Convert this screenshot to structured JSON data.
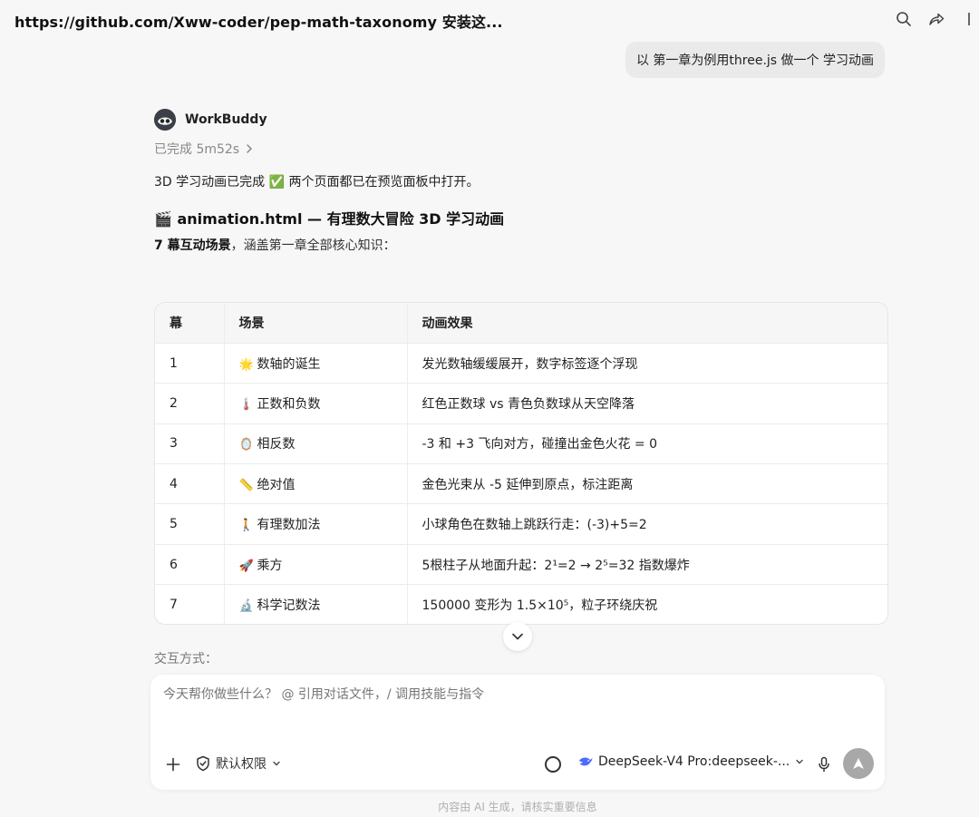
{
  "window": {
    "title": "https://github.com/Xww-coder/pep-math-taxonomy 安装这..."
  },
  "toolbar": {
    "icons": [
      "search-icon",
      "share-icon",
      "more-icon"
    ]
  },
  "conversation": {
    "user_message": "以 第一章为例用three.js 做一个 学习动画",
    "agent": {
      "name": "WorkBuddy",
      "status": "已完成 5m52s"
    },
    "reply": {
      "intro": "3D 学习动画已完成 ✅ 两个页面都已在预览面板中打开。",
      "heading": "🎬 animation.html — 有理数大冒险 3D 学习动画",
      "summary_bold": "7 幕互动场景",
      "summary_rest": "，涵盖第一章全部核心知识：",
      "table": {
        "headers": [
          "幕",
          "场景",
          "动画效果"
        ],
        "rows": [
          {
            "no": "1",
            "emoji": "🌟",
            "scene": "数轴的诞生",
            "effect": "发光数轴缓缓展开，数字标签逐个浮现"
          },
          {
            "no": "2",
            "emoji": "🌡️",
            "scene": "正数和负数",
            "effect": "红色正数球 vs 青色负数球从天空降落"
          },
          {
            "no": "3",
            "emoji": "🪞",
            "scene": "相反数",
            "effect": "-3 和 +3 飞向对方，碰撞出金色火花 = 0"
          },
          {
            "no": "4",
            "emoji": "📏",
            "scene": "绝对值",
            "effect": "金色光束从 -5 延伸到原点，标注距离"
          },
          {
            "no": "5",
            "emoji": "🚶",
            "scene": "有理数加法",
            "effect": "小球角色在数轴上跳跃行走：(-3)+5=2"
          },
          {
            "no": "6",
            "emoji": "🚀",
            "scene": "乘方",
            "effect": "5根柱子从地面升起：2¹=2 → 2⁵=32 指数爆炸"
          },
          {
            "no": "7",
            "emoji": "🔬",
            "scene": "科学记数法",
            "effect": "150000 变形为 1.5×10⁵，粒子环绕庆祝"
          }
        ]
      },
      "next_section": "交互方式："
    }
  },
  "composer": {
    "placeholder": "今天帮你做些什么？ @ 引用对话文件，/ 调用技能与指令",
    "permission_label": "默认权限",
    "model_label": "DeepSeek-V4 Pro:deepseek-..."
  },
  "footer": {
    "note": "内容由 AI 生成，请核实重要信息"
  },
  "colors": {
    "background": "#f7f7f7",
    "send_button": "#a8a8a8"
  }
}
